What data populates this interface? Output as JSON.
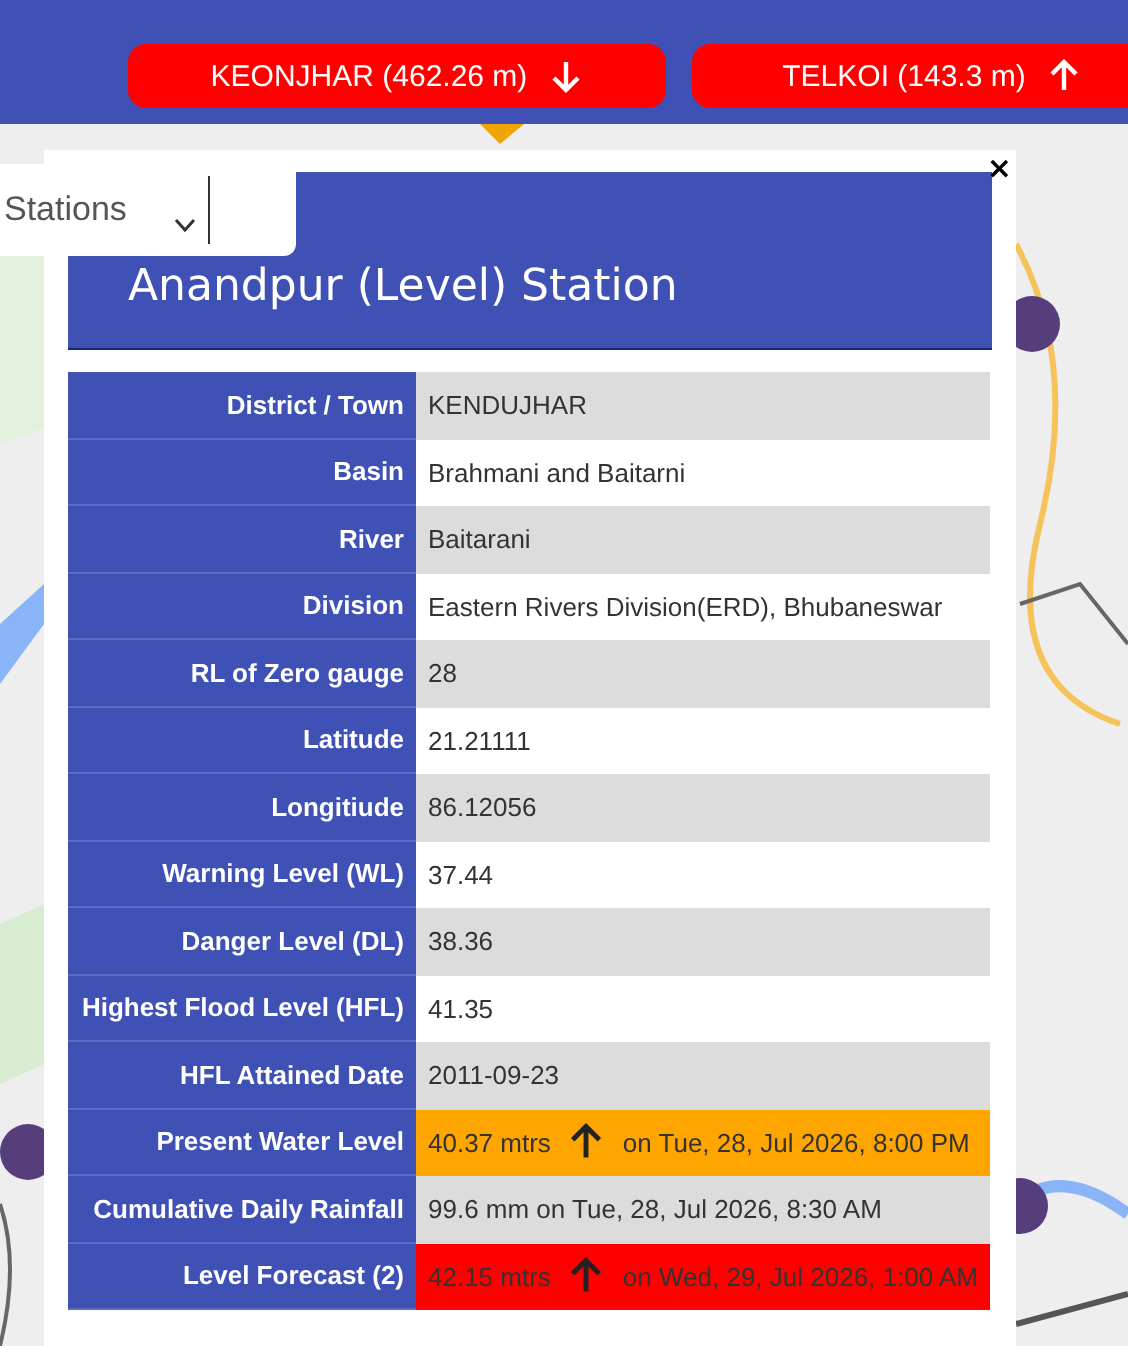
{
  "gauges": [
    {
      "label": "KEONJHAR (462.26 m)",
      "rising": false
    },
    {
      "label": "TELKOI (143.3 m)",
      "rising": true
    }
  ],
  "station_select": {
    "value": "Stations"
  },
  "popup": {
    "title": "Anandpur (Level) Station",
    "close": "×",
    "rows": [
      {
        "label": "District / Town",
        "value": "KENDUJHAR"
      },
      {
        "label": "Basin",
        "value": "Brahmani and Baitarni"
      },
      {
        "label": "River",
        "value": "Baitarani"
      },
      {
        "label": "Division",
        "value": "Eastern Rivers Division(ERD), Bhubaneswar"
      },
      {
        "label": "RL of Zero gauge",
        "value": "28"
      },
      {
        "label": "Latitude",
        "value": "21.21111"
      },
      {
        "label": "Longitiude",
        "value": "86.12056"
      },
      {
        "label": "Warning Level (WL)",
        "value": "37.44"
      },
      {
        "label": "Danger Level (DL)",
        "value": "38.36"
      },
      {
        "label": "Highest Flood Level (HFL)",
        "value": "41.35"
      },
      {
        "label": "HFL Attained Date",
        "value": "2011-09-23"
      },
      {
        "label": "Present Water Level",
        "kind": "trend",
        "value": "40.37 mtrs",
        "rising": true,
        "time": "on Tue, 28, Jul 2026, 8:00 PM",
        "color": "#ffa500"
      },
      {
        "label": "Cumulative Daily Rainfall",
        "value": "99.6 mm on Tue, 28, Jul 2026, 8:30 AM"
      },
      {
        "label": "Level Forecast (2)",
        "kind": "trend",
        "value": "42.15 mtrs",
        "rising": true,
        "time": "on Wed, 29, Jul 2026, 1:00 AM",
        "color": "#ff0000"
      }
    ]
  }
}
